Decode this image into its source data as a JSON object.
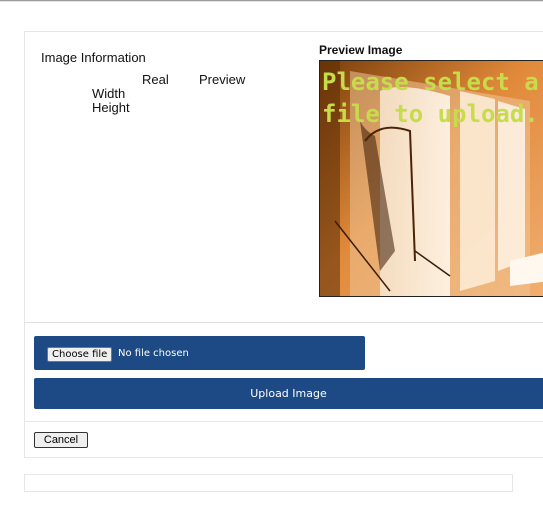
{
  "image_info": {
    "title": "Image Information",
    "col_real": "Real",
    "col_preview": "Preview",
    "row_width": "Width",
    "row_height": "Height"
  },
  "preview": {
    "title": "Preview Image",
    "placeholder_line1": "Please select a",
    "placeholder_line2": "file to upload."
  },
  "file_input": {
    "button_label": "Choose file",
    "status": "No file chosen"
  },
  "upload_button": {
    "label": "Upload Image"
  },
  "cancel_button": {
    "label": "Cancel"
  },
  "colors": {
    "primary": "#1d4a85",
    "preview_text": "#c7dc4a"
  }
}
